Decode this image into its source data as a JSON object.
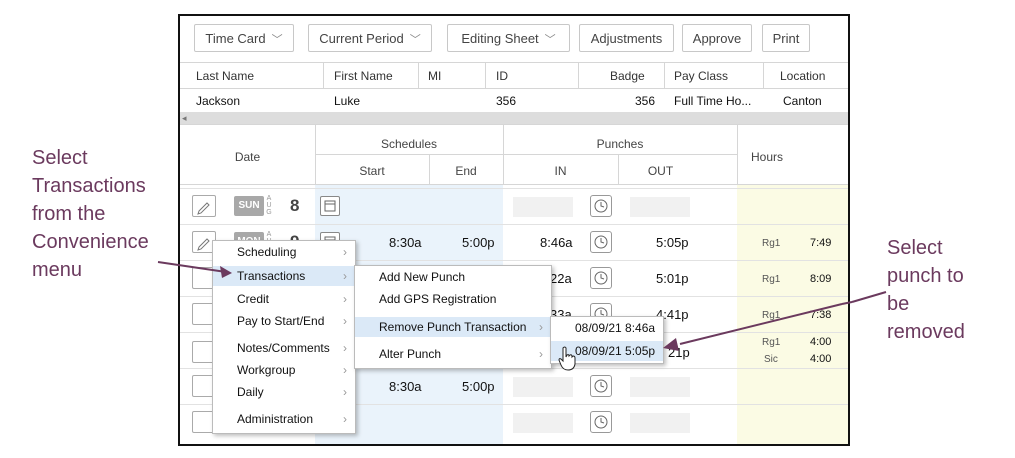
{
  "toolbar": {
    "time_card": "Time Card",
    "current_period": "Current Period",
    "editing_sheet": "Editing Sheet",
    "adjustments": "Adjustments",
    "approve": "Approve",
    "print": "Print"
  },
  "employee": {
    "headers": {
      "last_name": "Last Name",
      "first_name": "First Name",
      "mi": "MI",
      "id": "ID",
      "badge": "Badge",
      "pay_class": "Pay Class",
      "location": "Location"
    },
    "values": {
      "last_name": "Jackson",
      "first_name": "Luke",
      "mi": "",
      "id": "356",
      "badge": "356",
      "pay_class": "Full Time Ho...",
      "location": "Canton"
    }
  },
  "grid": {
    "date_header": "Date",
    "schedules_header": "Schedules",
    "start_header": "Start",
    "end_header": "End",
    "punches_header": "Punches",
    "in_header": "IN",
    "out_header": "OUT",
    "hours_header": "Hours",
    "rows": [
      {
        "day": "SUN",
        "month": "AUG",
        "date": "8",
        "start": "",
        "end": "",
        "in": "",
        "out": "",
        "hours": []
      },
      {
        "day": "MON",
        "month": "AUG",
        "date": "9",
        "start": "8:30a",
        "end": "5:00p",
        "in": "8:46a",
        "out": "5:05p",
        "hours": [
          {
            "code": "Rg1",
            "value": "7:49"
          }
        ]
      },
      {
        "day": "",
        "month": "",
        "date": "",
        "start": "",
        "end": "",
        "in": "22a",
        "out": "5:01p",
        "hours": [
          {
            "code": "Rg1",
            "value": "8:09"
          }
        ]
      },
      {
        "day": "",
        "month": "",
        "date": "",
        "start": "",
        "end": "",
        "in": "33a",
        "out": "4:41p",
        "hours": [
          {
            "code": "Rg1",
            "value": "7:38"
          }
        ]
      },
      {
        "day": "",
        "month": "",
        "date": "",
        "start": "",
        "end": "",
        "in": "",
        "out": "21p",
        "hours": [
          {
            "code": "Rg1",
            "value": "4:00"
          },
          {
            "code": "Sic",
            "value": "4:00"
          }
        ]
      },
      {
        "day": "",
        "month": "",
        "date": "",
        "start": "8:30a",
        "end": "5:00p",
        "in": "",
        "out": "",
        "hours": []
      },
      {
        "day": "",
        "month": "",
        "date": "",
        "start": "",
        "end": "",
        "in": "",
        "out": "",
        "hours": []
      }
    ]
  },
  "context_menu": {
    "items": [
      "Scheduling",
      "Transactions",
      "Credit",
      "Pay to Start/End",
      "Notes/Comments",
      "Workgroup",
      "Daily",
      "Administration"
    ]
  },
  "transactions_menu": {
    "items": [
      "Add New Punch",
      "Add GPS Registration",
      "Remove Punch Transaction",
      "Alter Punch"
    ]
  },
  "punch_menu": {
    "items": [
      "08/09/21 8:46a",
      "08/09/21 5:05p"
    ]
  },
  "annotations": {
    "left": [
      "Select",
      "Transactions",
      "from the",
      "Convenience",
      "menu"
    ],
    "right": [
      "Select",
      "punch to",
      "be",
      "removed"
    ]
  },
  "colors": {
    "annotation": "#6b3a5e",
    "schedule_bg": "#eaf3fb",
    "hours_bg": "#fbfbe4",
    "highlight": "#dbe9f7"
  }
}
